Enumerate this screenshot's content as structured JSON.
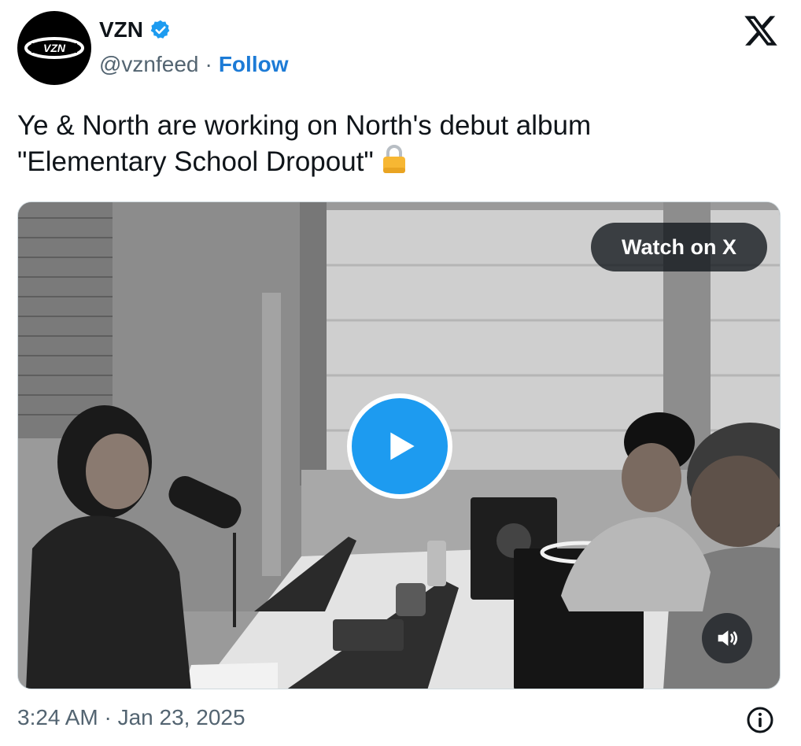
{
  "author": {
    "name": "VZN",
    "handle": "@vznfeed",
    "separator": "·",
    "follow_label": "Follow",
    "avatar_text": "VZN",
    "verified_icon": "verified-badge-icon"
  },
  "tweet": {
    "text_line1": "Ye & North are working on North's debut album",
    "text_line2": "\"Elementary School Dropout\"",
    "emoji": "lock-icon"
  },
  "media": {
    "watch_label": "Watch on X",
    "play_icon": "play-icon",
    "sound_icon": "speaker-icon"
  },
  "footer": {
    "timestamp": "3:24 AM · Jan 23, 2025",
    "info_icon": "info-icon"
  },
  "colors": {
    "accent": "#1d9bf0",
    "follow": "#1d7bd6",
    "text": "#0f1419",
    "secondary": "#536471",
    "lock": "#f7b733"
  }
}
